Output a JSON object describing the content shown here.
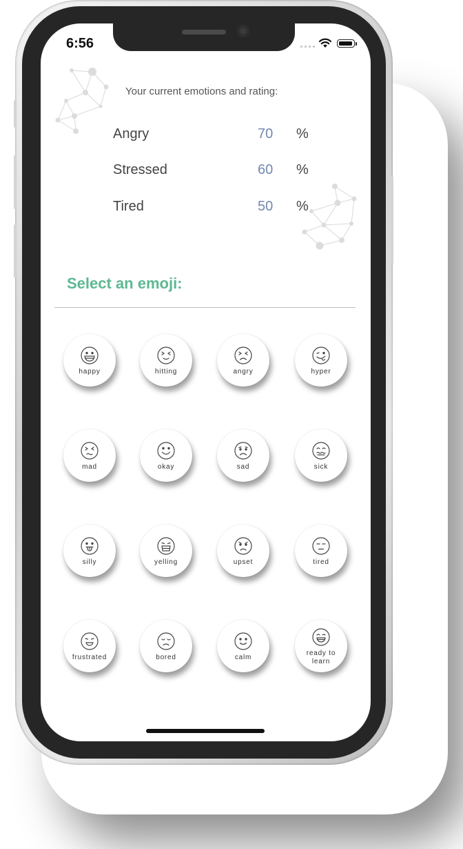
{
  "status_bar": {
    "time": "6:56"
  },
  "current_emotions": {
    "heading": "Your current emotions and rating:",
    "items": [
      {
        "name": "Angry",
        "value": "70",
        "unit": "%"
      },
      {
        "name": "Stressed",
        "value": "60",
        "unit": "%"
      },
      {
        "name": "Tired",
        "value": "50",
        "unit": "%"
      }
    ]
  },
  "emoji_section": {
    "title": "Select an emoji:",
    "emojis": [
      {
        "label": "happy",
        "icon": "grinning-face-icon"
      },
      {
        "label": "hitting",
        "icon": "squinting-face-icon"
      },
      {
        "label": "angry",
        "icon": "frowning-squint-face-icon"
      },
      {
        "label": "hyper",
        "icon": "winking-tongue-face-icon"
      },
      {
        "label": "mad",
        "icon": "mad-face-icon"
      },
      {
        "label": "okay",
        "icon": "smiling-face-icon"
      },
      {
        "label": "sad",
        "icon": "sad-face-icon"
      },
      {
        "label": "sick",
        "icon": "nauseated-face-icon"
      },
      {
        "label": "silly",
        "icon": "tongue-out-face-icon"
      },
      {
        "label": "yelling",
        "icon": "yelling-face-icon"
      },
      {
        "label": "upset",
        "icon": "upset-face-icon"
      },
      {
        "label": "tired",
        "icon": "tired-face-icon"
      },
      {
        "label": "frustrated",
        "icon": "frustrated-face-icon"
      },
      {
        "label": "bored",
        "icon": "bored-face-icon"
      },
      {
        "label": "calm",
        "icon": "calm-face-icon"
      },
      {
        "label": "ready to learn",
        "icon": "eager-face-icon"
      }
    ]
  },
  "colors": {
    "accent_green": "#5db893",
    "rating_blue": "#7388b0",
    "text_dark": "#444444"
  }
}
